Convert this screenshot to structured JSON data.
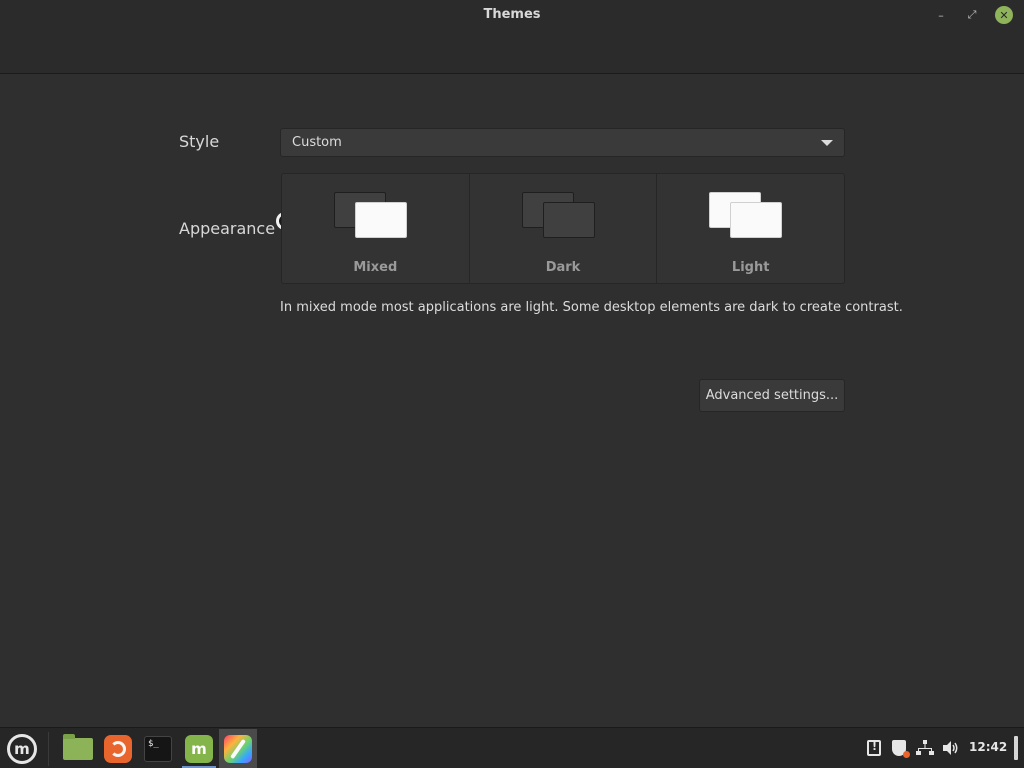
{
  "window": {
    "title": "Themes",
    "controls": {
      "minimize": "–",
      "maximize": "⤢",
      "close": "✕"
    }
  },
  "style": {
    "label": "Style",
    "selected": "Custom"
  },
  "appearance": {
    "label": "Appearance",
    "options": [
      {
        "label": "Mixed",
        "icon": "mixed-theme-icon"
      },
      {
        "label": "Dark",
        "icon": "dark-theme-icon"
      },
      {
        "label": "Light",
        "icon": "light-theme-icon"
      }
    ],
    "description": "In mixed mode most applications are light. Some desktop elements are dark to create contrast."
  },
  "advanced_button": "Advanced settings...",
  "taskbar": {
    "menu_glyph": "m",
    "terminal_glyph": "$_",
    "mint_glyph": "m",
    "tray": {
      "clock": "12:42"
    }
  },
  "colors": {
    "background": "#2f2f2f",
    "accent_green": "#8fb35a",
    "firefox_orange": "#e8662d",
    "active_indicator": "#6f93c7"
  }
}
